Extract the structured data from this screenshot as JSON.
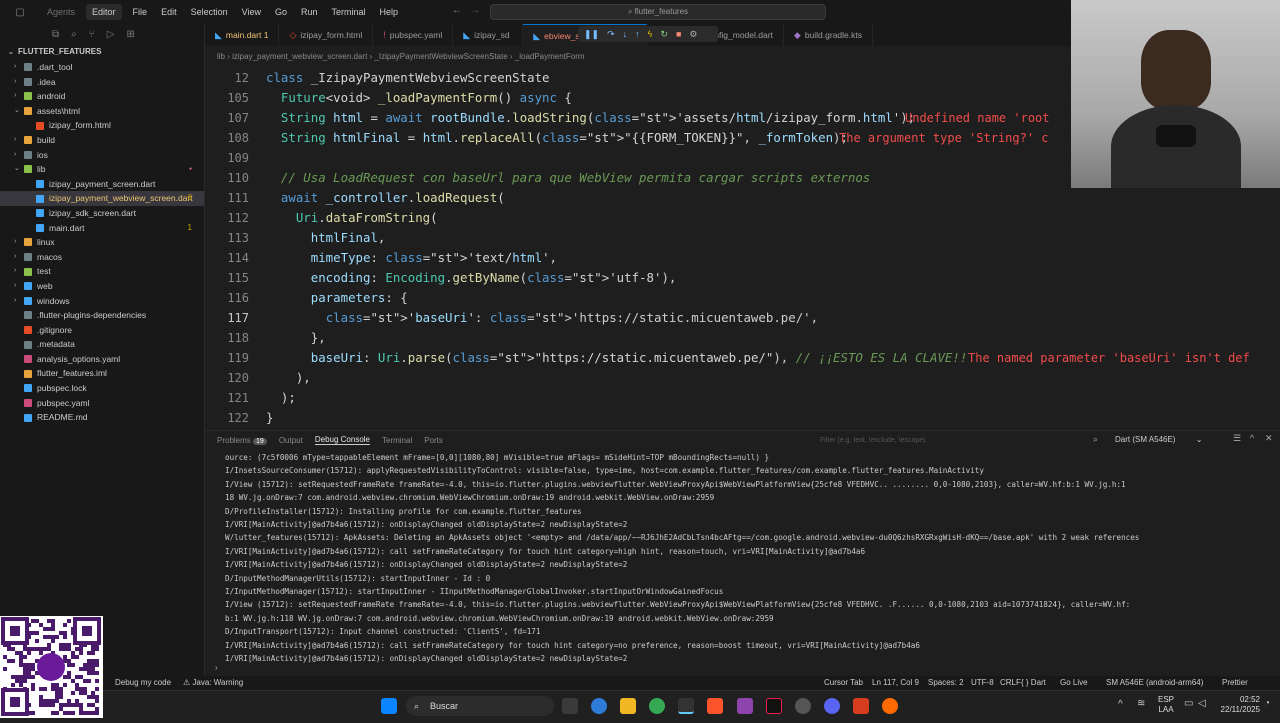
{
  "titlebar": {
    "menu": [
      "Agents",
      "Editor",
      "File",
      "Edit",
      "Selection",
      "View",
      "Go",
      "Run",
      "Terminal",
      "Help"
    ],
    "search": "flutter_features"
  },
  "explorer": {
    "root": "FLUTTER_FEATURES",
    "items": [
      {
        "label": ".dart_tool",
        "depth": 1,
        "kind": "folder",
        "color": "#6d8086"
      },
      {
        "label": ".idea",
        "depth": 1,
        "kind": "folder",
        "color": "#6d8086"
      },
      {
        "label": "android",
        "depth": 1,
        "kind": "folder",
        "color": "#8bc34a"
      },
      {
        "label": "assets\\html",
        "depth": 1,
        "kind": "folder-open",
        "color": "#e8a33d"
      },
      {
        "label": "izipay_form.html",
        "depth": 2,
        "kind": "file",
        "color": "#e44d26"
      },
      {
        "label": "build",
        "depth": 1,
        "kind": "folder",
        "color": "#e8a33d"
      },
      {
        "label": "ios",
        "depth": 1,
        "kind": "folder",
        "color": "#6d8086"
      },
      {
        "label": "lib",
        "depth": 1,
        "kind": "folder-open",
        "color": "#8bc34a",
        "badge_dot": true
      },
      {
        "label": "izipay_payment_screen.dart",
        "depth": 2,
        "kind": "file",
        "color": "#42a5f5"
      },
      {
        "label": "izipay_payment_webview_screen.dart",
        "depth": 2,
        "kind": "file",
        "color": "#42a5f5",
        "selected": true,
        "badge": "6"
      },
      {
        "label": "izipay_sdk_screen.dart",
        "depth": 2,
        "kind": "file",
        "color": "#42a5f5"
      },
      {
        "label": "main.dart",
        "depth": 2,
        "kind": "file",
        "color": "#42a5f5",
        "badge": "1"
      },
      {
        "label": "linux",
        "depth": 1,
        "kind": "folder",
        "color": "#e8a33d"
      },
      {
        "label": "macos",
        "depth": 1,
        "kind": "folder",
        "color": "#6d8086"
      },
      {
        "label": "test",
        "depth": 1,
        "kind": "folder",
        "color": "#8bc34a"
      },
      {
        "label": "web",
        "depth": 1,
        "kind": "folder",
        "color": "#42a5f5"
      },
      {
        "label": "windows",
        "depth": 1,
        "kind": "folder",
        "color": "#42a5f5"
      },
      {
        "label": ".flutter-plugins-dependencies",
        "depth": 1,
        "kind": "file",
        "color": "#6d8086"
      },
      {
        "label": ".gitignore",
        "depth": 1,
        "kind": "file",
        "color": "#e44d26"
      },
      {
        "label": ".metadata",
        "depth": 1,
        "kind": "file",
        "color": "#6d8086"
      },
      {
        "label": "analysis_options.yaml",
        "depth": 1,
        "kind": "file",
        "color": "#cb4b7a"
      },
      {
        "label": "flutter_features.iml",
        "depth": 1,
        "kind": "file",
        "color": "#e8a33d"
      },
      {
        "label": "pubspec.lock",
        "depth": 1,
        "kind": "file",
        "color": "#42a5f5"
      },
      {
        "label": "pubspec.yaml",
        "depth": 1,
        "kind": "file",
        "color": "#cb4b7a"
      },
      {
        "label": "README.md",
        "depth": 1,
        "kind": "file",
        "color": "#42a5f5"
      }
    ]
  },
  "tabs": [
    {
      "label": "main.dart 1",
      "icon": "dart-icon"
    },
    {
      "label": "izipay_form.html",
      "icon": "html-icon"
    },
    {
      "label": "pubspec.yaml",
      "icon": "yaml-icon"
    },
    {
      "label": "izipay_sd",
      "icon": "dart-icon"
    },
    {
      "label": "ebview_screen.dart 6",
      "icon": "dart-icon",
      "active": true
    },
    {
      "label": "payment_config_model.dart",
      "icon": "dart-icon"
    },
    {
      "label": "build.gradle.kts",
      "icon": "gradle-icon"
    }
  ],
  "breadcrumb": "lib  ›  izipay_payment_webview_screen.dart  ›  _IzipayPaymentWebviewScreenState  ›  _loadPaymentForm",
  "code": [
    {
      "n": "12",
      "text": "class _IzipayPaymentWebviewScreenState"
    },
    {
      "n": "105",
      "text": "  Future<void> _loadPaymentForm() async {"
    },
    {
      "n": "107",
      "text": "  String html = await rootBundle.loadString('assets/html/izipay_form.html');",
      "err": "Undefined name 'root"
    },
    {
      "n": "108",
      "text": "  String htmlFinal = html.replaceAll(\"{{FORM_TOKEN}}\", _formToken);",
      "err": "The argument type 'String?' c"
    },
    {
      "n": "109",
      "text": ""
    },
    {
      "n": "110",
      "text": "  // Usa LoadRequest con baseUrl para que WebView permita cargar scripts externos"
    },
    {
      "n": "111",
      "text": "  await _controller.loadRequest("
    },
    {
      "n": "112",
      "text": "    Uri.dataFromString("
    },
    {
      "n": "113",
      "text": "      htmlFinal,"
    },
    {
      "n": "114",
      "text": "      mimeType: 'text/html',"
    },
    {
      "n": "115",
      "text": "      encoding: Encoding.getByName('utf-8'),"
    },
    {
      "n": "116",
      "text": "      parameters: {"
    },
    {
      "n": "117",
      "text": "        'baseUri': 'https://static.micuentaweb.pe/',"
    },
    {
      "n": "118",
      "text": "      },"
    },
    {
      "n": "119",
      "text": "      baseUri: Uri.parse(\"https://static.micuentaweb.pe/\"), // ¡¡ESTO ES LA CLAVE!!",
      "err": "The named parameter 'baseUri' isn't def"
    },
    {
      "n": "120",
      "text": "    ),"
    },
    {
      "n": "121",
      "text": "  );"
    },
    {
      "n": "122",
      "text": "}"
    }
  ],
  "panel": {
    "tabs": [
      "Problems",
      "Output",
      "Debug Console",
      "Terminal",
      "Ports"
    ],
    "problems_count": "19",
    "filter_placeholder": "Filter (e.g. text, !exclude, \\escape)",
    "device": "Dart (SM A546E)",
    "lines": [
      "ource: (7c5f0006 mType=tappableElement mFrame=[0,0][1080,80] mVisible=true mFlags= mSideHint=TOP mBoundingRects=null) }",
      "I/InsetsSourceConsumer(15712): applyRequestedVisibilityToControl: visible=false, type=ime, host=com.example.flutter_features/com.example.flutter_features.MainActivity",
      "I/View    (15712): setRequestedFrameRate frameRate=-4.0, this=io.flutter.plugins.webviewflutter.WebViewProxyApi$WebViewPlatformView{25cfe8 VFEDHVC.. ........ 0,0-1080,2103}, caller=WV.hf:b:1 WV.jg.h:1",
      "  18 WV.jg.onDraw:7 com.android.webview.chromium.WebViewChromium.onDraw:19 android.webkit.WebView.onDraw:2959",
      "D/ProfileInstaller(15712): Installing profile for com.example.flutter_features",
      "I/VRI[MainActivity]@ad7b4a6(15712): onDisplayChanged oldDisplayState=2 newDisplayState=2",
      "W/lutter_features(15712): ApkAssets: Deleting an ApkAssets object '<empty> and /data/app/~~RJ6JhE2AdCbLTsn4bcAFtg==/com.google.android.webview-du0Q6zhsRXGRxgWisH-dKQ==/base.apk' with 2 weak references",
      "I/VRI[MainActivity]@ad7b4a6(15712): call setFrameRateCategory for touch hint category=high hint, reason=touch, vri=VRI[MainActivity]@ad7b4a6",
      "I/VRI[MainActivity]@ad7b4a6(15712): onDisplayChanged oldDisplayState=2 newDisplayState=2",
      "D/InputMethodManagerUtils(15712): startInputInner - Id : 0",
      "I/InputMethodManager(15712): startInputInner - IInputMethodManagerGlobalInvoker.startInputOrWindowGainedFocus",
      "I/View    (15712): setRequestedFrameRate frameRate=-4.0, this=io.flutter.plugins.webviewflutter.WebViewProxyApi$WebViewPlatformView{25cfe8 VFEDHVC. .F...... 0,0-1080,2103 aid=1073741824}, caller=WV.hf:",
      "b:1 WV.jg.h:118 WV.jg.onDraw:7 com.android.webview.chromium.WebViewChromium.onDraw:19 android.webkit.WebView.onDraw:2959",
      "D/InputTransport(15712): Input channel constructed: 'ClientS', fd=171",
      "I/VRI[MainActivity]@ad7b4a6(15712): call setFrameRateCategory for touch hint category=no preference, reason=boost timeout, vri=VRI[MainActivity]@ad7b4a6",
      "I/VRI[MainActivity]@ad7b4a6(15712): onDisplayChanged oldDisplayState=2 newDisplayState=2"
    ]
  },
  "statusbar": {
    "left": [
      "Debug my code",
      "Java: Warning"
    ],
    "right": [
      "Cursor Tab",
      "Ln 117, Col 9",
      "Spaces: 2",
      "UTF-8",
      "CRLF",
      "{ } Dart",
      "Go Live",
      "SM A546E (android-arm64)",
      "Prettier"
    ]
  },
  "taskbar": {
    "search": "Buscar",
    "lang": "ESP",
    "lang2": "LAA",
    "time": "02:52",
    "date": "22/11/2025"
  },
  "colors": {
    "accent": "#0078d4",
    "error": "#f14c4c"
  }
}
